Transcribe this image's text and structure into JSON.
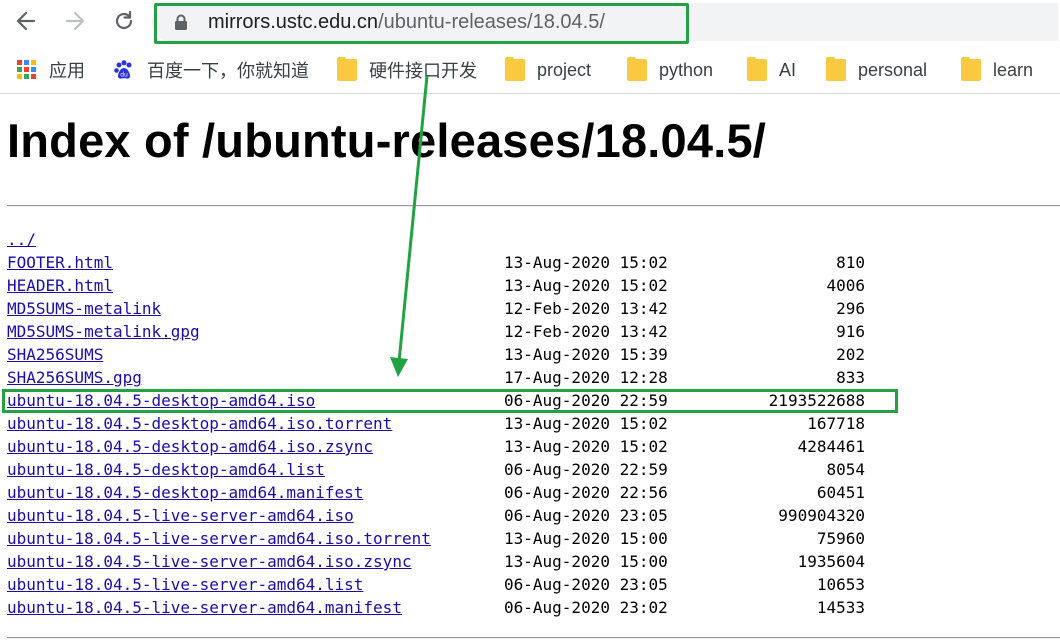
{
  "browser": {
    "url_host": "mirrors.ustc.edu.cn",
    "url_path": "/ubuntu-releases/18.04.5/",
    "highlight_color": "#22a243"
  },
  "bookmarks": [
    {
      "label": "应用",
      "icon": "apps-grid-icon"
    },
    {
      "label": "百度一下，你就知道",
      "icon": "baidu-paw-icon"
    },
    {
      "label": "硬件接口开发",
      "icon": "folder-icon"
    },
    {
      "label": "project",
      "icon": "folder-icon"
    },
    {
      "label": "python",
      "icon": "folder-icon"
    },
    {
      "label": "AI",
      "icon": "folder-icon"
    },
    {
      "label": "personal",
      "icon": "folder-icon"
    },
    {
      "label": "learn",
      "icon": "folder-icon"
    }
  ],
  "page": {
    "title": "Index of /ubuntu-releases/18.04.5/",
    "parent_link": "../"
  },
  "files": [
    {
      "name": "FOOTER.html",
      "date": "13-Aug-2020 15:02",
      "size": "810"
    },
    {
      "name": "HEADER.html",
      "date": "13-Aug-2020 15:02",
      "size": "4006"
    },
    {
      "name": "MD5SUMS-metalink",
      "date": "12-Feb-2020 13:42",
      "size": "296"
    },
    {
      "name": "MD5SUMS-metalink.gpg",
      "date": "12-Feb-2020 13:42",
      "size": "916"
    },
    {
      "name": "SHA256SUMS",
      "date": "13-Aug-2020 15:39",
      "size": "202"
    },
    {
      "name": "SHA256SUMS.gpg",
      "date": "17-Aug-2020 12:28",
      "size": "833"
    },
    {
      "name": "ubuntu-18.04.5-desktop-amd64.iso",
      "date": "06-Aug-2020 22:59",
      "size": "2193522688"
    },
    {
      "name": "ubuntu-18.04.5-desktop-amd64.iso.torrent",
      "date": "13-Aug-2020 15:02",
      "size": "167718"
    },
    {
      "name": "ubuntu-18.04.5-desktop-amd64.iso.zsync",
      "date": "13-Aug-2020 15:02",
      "size": "4284461"
    },
    {
      "name": "ubuntu-18.04.5-desktop-amd64.list",
      "date": "06-Aug-2020 22:59",
      "size": "8054"
    },
    {
      "name": "ubuntu-18.04.5-desktop-amd64.manifest",
      "date": "06-Aug-2020 22:56",
      "size": "60451"
    },
    {
      "name": "ubuntu-18.04.5-live-server-amd64.iso",
      "date": "06-Aug-2020 23:05",
      "size": "990904320"
    },
    {
      "name": "ubuntu-18.04.5-live-server-amd64.iso.torrent",
      "date": "13-Aug-2020 15:00",
      "size": "75960"
    },
    {
      "name": "ubuntu-18.04.5-live-server-amd64.iso.zsync",
      "date": "13-Aug-2020 15:00",
      "size": "1935604"
    },
    {
      "name": "ubuntu-18.04.5-live-server-amd64.list",
      "date": "06-Aug-2020 23:05",
      "size": "10653"
    },
    {
      "name": "ubuntu-18.04.5-live-server-amd64.manifest",
      "date": "06-Aug-2020 23:02",
      "size": "14533"
    }
  ]
}
